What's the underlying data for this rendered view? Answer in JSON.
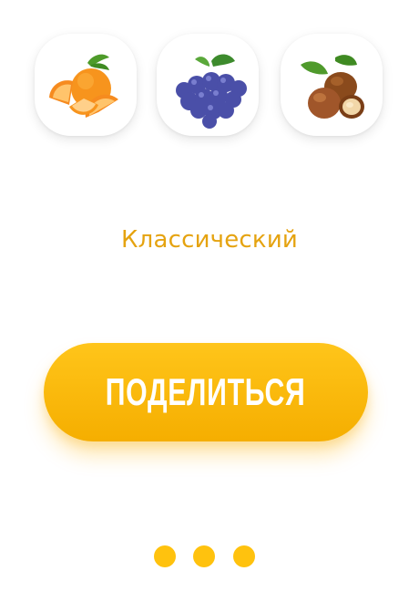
{
  "ingredients": [
    {
      "icon": "orange-slices-icon"
    },
    {
      "icon": "grape-bunch-icon"
    },
    {
      "icon": "hazelnuts-icon"
    }
  ],
  "flavor": {
    "label": "Классический"
  },
  "share_button": {
    "label": "ПОДЕЛИТЬСЯ"
  },
  "pager": {
    "count": 3
  },
  "colors": {
    "accent": "#F5B50C",
    "button_gradient_top": "#FFC51A",
    "button_gradient_bottom": "#F5AE00",
    "text_label": "#E5A310",
    "dot": "#FFC20E"
  }
}
